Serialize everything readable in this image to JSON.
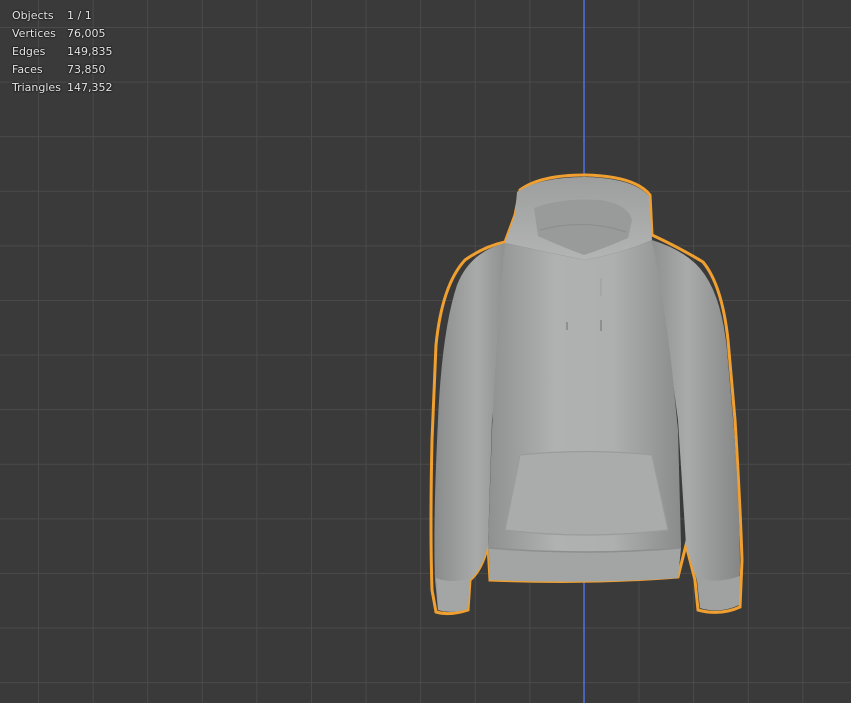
{
  "overlay": {
    "stats": [
      {
        "label": "Objects",
        "value": "1 / 1"
      },
      {
        "label": "Vertices",
        "value": "76,005"
      },
      {
        "label": "Edges",
        "value": "149,835"
      },
      {
        "label": "Faces",
        "value": "73,850"
      },
      {
        "label": "Triangles",
        "value": "147,352"
      }
    ]
  },
  "colors": {
    "viewport_background": "#3a3a3a",
    "grid_line": "#4a4a4a",
    "z_axis": "#4a6ad0",
    "selection_outline": "#f0a030",
    "mesh_base": "#a8a9a9"
  }
}
